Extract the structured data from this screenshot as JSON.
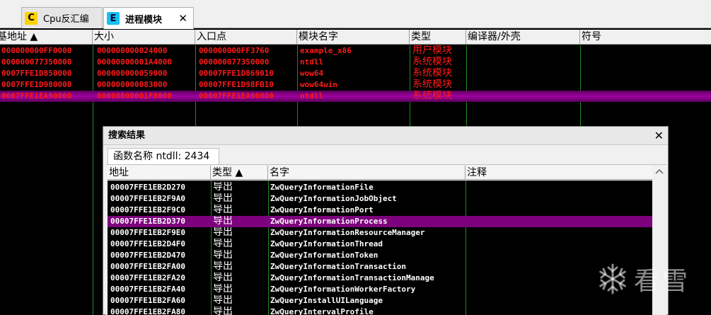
{
  "tabs": [
    {
      "icon_letter": "C",
      "label": "Cpu反汇编"
    },
    {
      "icon_letter": "E",
      "label": "进程模块",
      "close": "✕"
    }
  ],
  "modules": {
    "columns": [
      "基地址 ▲",
      "大小",
      "入口点",
      "模块名字",
      "类型",
      "编译器/外壳",
      "符号"
    ],
    "rows": [
      {
        "base": "000000000FF0000",
        "size": "000000000024000",
        "entry": "000000000FF3760",
        "name": "example_x86",
        "type": "用户模块"
      },
      {
        "base": "000000077350000",
        "size": "00000000001A4000",
        "entry": "000000077350000",
        "name": "ntdll",
        "type": "系统模块"
      },
      {
        "base": "0007FFE1D850000",
        "size": "000000000059000",
        "entry": "00007FFE1D869010",
        "name": "wow64",
        "type": "系统模块"
      },
      {
        "base": "0007FFE1D980000",
        "size": "000000000083000",
        "entry": "00007FFE1D98FB10",
        "name": "wow64win",
        "type": "系统模块"
      },
      {
        "base": "0007FFE1EA90000",
        "size": "00000000001F8000",
        "entry": "00007FFE1EA90000",
        "name": "ntdll",
        "type": "系统模块"
      }
    ],
    "selected_index": 4
  },
  "search": {
    "title": "搜索结果",
    "close": "✕",
    "subtab": "函数名称 ntdll: 2434",
    "columns": [
      "地址",
      "类型 ▲",
      "名字",
      "注释"
    ],
    "rows": [
      {
        "addr": "00007FFE1EB2D270",
        "type": "导出",
        "name": "ZwQueryInformationFile"
      },
      {
        "addr": "00007FFE1EB2F9A0",
        "type": "导出",
        "name": "ZwQueryInformationJobObject"
      },
      {
        "addr": "00007FFE1EB2F9C0",
        "type": "导出",
        "name": "ZwQueryInformationPort"
      },
      {
        "addr": "00007FFE1EB2D370",
        "type": "导出",
        "name": "ZwQueryInformationProcess"
      },
      {
        "addr": "00007FFE1EB2F9E0",
        "type": "导出",
        "name": "ZwQueryInformationResourceManager"
      },
      {
        "addr": "00007FFE1EB2D4F0",
        "type": "导出",
        "name": "ZwQueryInformationThread"
      },
      {
        "addr": "00007FFE1EB2D470",
        "type": "导出",
        "name": "ZwQueryInformationToken"
      },
      {
        "addr": "00007FFE1EB2FA00",
        "type": "导出",
        "name": "ZwQueryInformationTransaction"
      },
      {
        "addr": "00007FFE1EB2FA20",
        "type": "导出",
        "name": "ZwQueryInformationTransactionManage"
      },
      {
        "addr": "00007FFE1EB2FA40",
        "type": "导出",
        "name": "ZwQueryInformationWorkerFactory"
      },
      {
        "addr": "00007FFE1EB2FA60",
        "type": "导出",
        "name": "ZwQueryInstallUILanguage"
      },
      {
        "addr": "00007FFE1EB2FA80",
        "type": "导出",
        "name": "ZwQueryIntervalProfile"
      }
    ],
    "selected_index": 3
  },
  "watermark": {
    "text": "看雪",
    "icon": "snowflake-icon"
  },
  "colors": {
    "module_text": "#ff1a1a",
    "selection": "#7d007d",
    "grid_line": "#1e8c1e",
    "background": "#000000"
  }
}
